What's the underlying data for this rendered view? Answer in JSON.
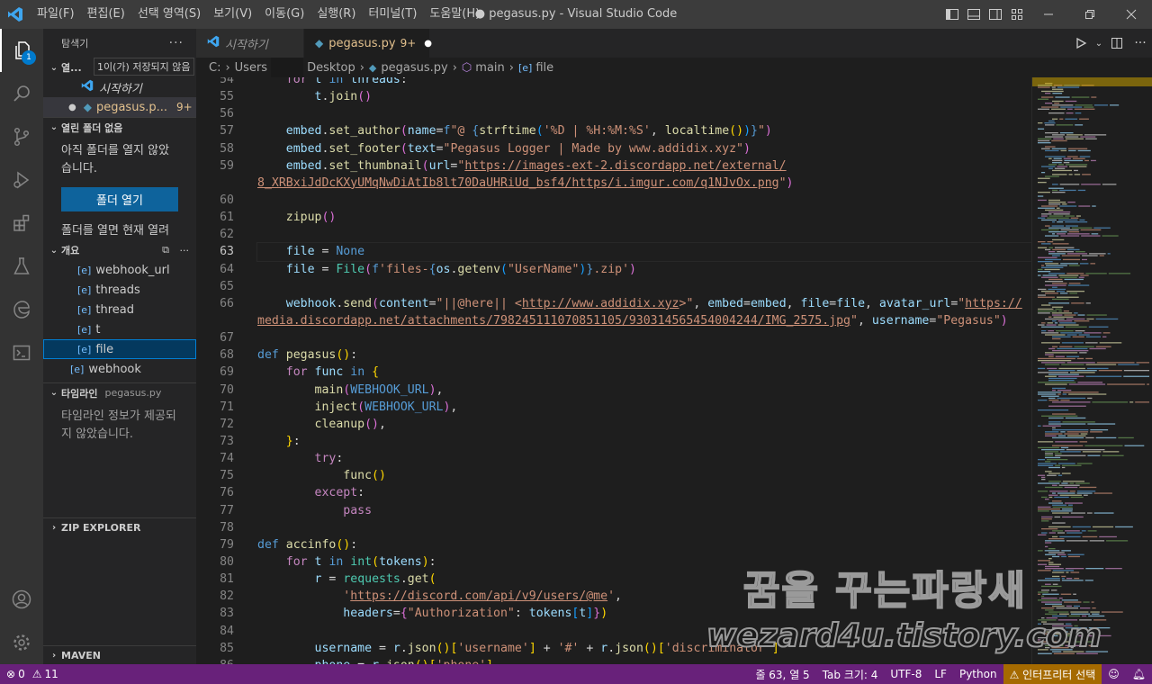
{
  "titlebar": {
    "menu": [
      "파일(F)",
      "편집(E)",
      "선택 영역(S)",
      "보기(V)",
      "이동(G)",
      "실행(R)",
      "터미널(T)",
      "도움말(H)"
    ],
    "title": "● pegasus.py - Visual Studio Code"
  },
  "activity": {
    "explorer_badge": "1"
  },
  "sidebar": {
    "title": "탐색기",
    "open_editors_label": "열...",
    "tooltip": "1이(가) 저장되지 않음",
    "open_items": [
      {
        "label": "시작하기"
      },
      {
        "label": "pegasus.p...",
        "badge": "9+"
      }
    ],
    "no_folder_header": "열린 폴더 없음",
    "no_folder_text": "아직 폴더를 열지 않았습니다.",
    "open_folder_button": "폴더 열기",
    "open_folder_hint": "폴더를 열면 현재 열려",
    "outline_header": "개요",
    "outline_items": [
      "webhook_url",
      "threads",
      "thread",
      "t",
      "file",
      "webhook"
    ],
    "timeline_header": "타임라인",
    "timeline_file": "pegasus.py",
    "timeline_text": "타임라인 정보가 제공되지 않았습니다.",
    "zip_header": "ZIP EXPLORER",
    "maven_header": "MAVEN"
  },
  "tabs": [
    {
      "label": "시작하기",
      "active": false
    },
    {
      "label": "pegasus.py",
      "badge": "9+",
      "dirty": "●",
      "active": true
    }
  ],
  "breadcrumb": [
    "C:",
    "Users",
    "Desktop",
    "pegasus.py",
    "main",
    "file"
  ],
  "editor": {
    "current_line": 63,
    "line_numbers": [
      54,
      55,
      56,
      57,
      58,
      59,
      "",
      60,
      61,
      62,
      63,
      64,
      65,
      66,
      "",
      67,
      68,
      69,
      70,
      71,
      72,
      73,
      74,
      75,
      76,
      77,
      78,
      79,
      80,
      81,
      82,
      83,
      84,
      85,
      86
    ]
  },
  "statusbar": {
    "errors": "0",
    "warnings": "11",
    "position": "줄 63, 열 5",
    "tab_size": "Tab 크기: 4",
    "encoding": "UTF-8",
    "eol": "LF",
    "language": "Python",
    "interpreter": "⚠ 인터프리터 선택"
  },
  "watermark": {
    "line1": "꿈을 꾸는파랑새",
    "line2": "wezard4u.tistory.com"
  }
}
